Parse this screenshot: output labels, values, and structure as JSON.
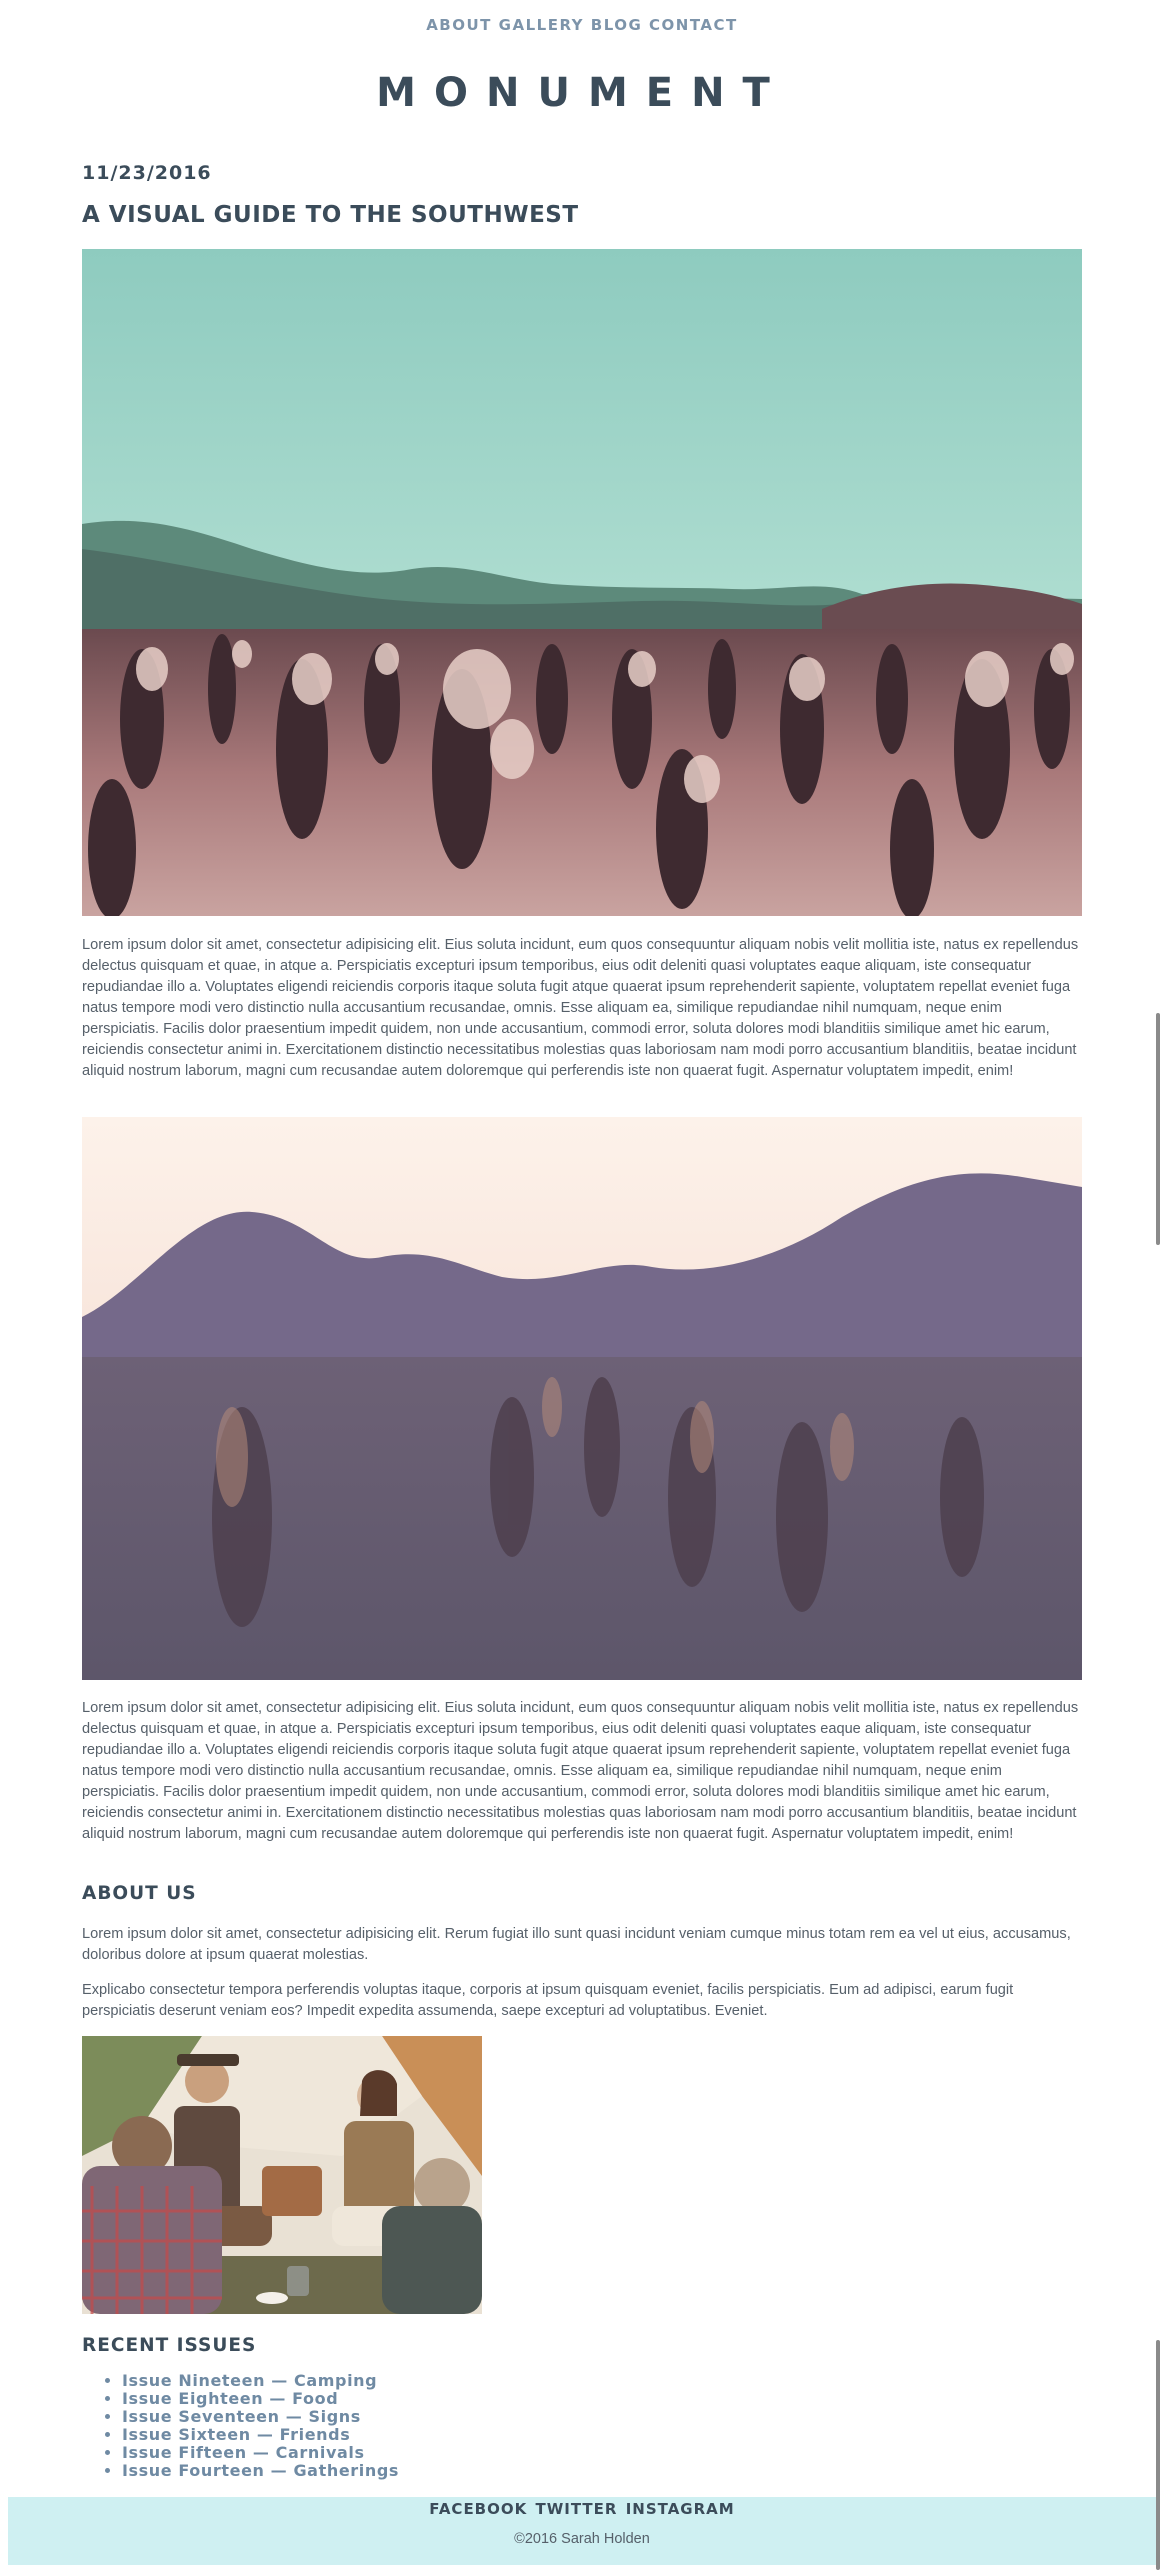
{
  "nav": {
    "links": [
      "ABOUT",
      "GALLERY",
      "BLOG",
      "CONTACT"
    ]
  },
  "site": {
    "brand": "MONUMENT"
  },
  "post": {
    "date": "11/23/2016",
    "title": "A VISUAL GUIDE TO THE SOUTHWEST",
    "paragraph1": "Lorem ipsum dolor sit amet, consectetur adipisicing elit. Eius soluta incidunt, eum quos consequuntur aliquam nobis velit mollitia iste, natus ex repellendus delectus quisquam et quae, in atque a. Perspiciatis excepturi ipsum temporibus, eius odit deleniti quasi voluptates eaque aliquam, iste consequatur repudiandae illo a. Voluptates eligendi reiciendis corporis itaque soluta fugit atque quaerat ipsum reprehenderit sapiente, voluptatem repellat eveniet fuga natus tempore modi vero distinctio nulla accusantium recusandae, omnis. Esse aliquam ea, similique repudiandae nihil numquam, neque enim perspiciatis. Facilis dolor praesentium impedit quidem, non unde accusantium, commodi error, soluta dolores modi blanditiis similique amet hic earum, reiciendis consectetur animi in. Exercitationem distinctio necessitatibus molestias quas laboriosam nam modi porro accusantium blanditiis, beatae incidunt aliquid nostrum laborum, magni cum recusandae autem doloremque qui perferendis iste non quaerat fugit. Aspernatur voluptatem impedit, enim!",
    "paragraph2": "Lorem ipsum dolor sit amet, consectetur adipisicing elit. Eius soluta incidunt, eum quos consequuntur aliquam nobis velit mollitia iste, natus ex repellendus delectus quisquam et quae, in atque a. Perspiciatis excepturi ipsum temporibus, eius odit deleniti quasi voluptates eaque aliquam, iste consequatur repudiandae illo a. Voluptates eligendi reiciendis corporis itaque soluta fugit atque quaerat ipsum reprehenderit sapiente, voluptatem repellat eveniet fuga natus tempore modi vero distinctio nulla accusantium recusandae, omnis. Esse aliquam ea, similique repudiandae nihil numquam, neque enim perspiciatis. Facilis dolor praesentium impedit quidem, non unde accusantium, commodi error, soluta dolores modi blanditiis similique amet hic earum, reiciendis consectetur animi in. Exercitationem distinctio necessitatibus molestias quas laboriosam nam modi porro accusantium blanditiis, beatae incidunt aliquid nostrum laborum, magni cum recusandae autem doloremque qui perferendis iste non quaerat fugit. Aspernatur voluptatem impedit, enim!"
  },
  "about": {
    "heading": "ABOUT US",
    "paragraph1": "Lorem ipsum dolor sit amet, consectetur adipisicing elit. Rerum fugiat illo sunt quasi incidunt veniam cumque minus totam rem ea vel ut eius, accusamus, doloribus dolore at ipsum quaerat molestias.",
    "paragraph2": "Explicabo consectetur tempora perferendis voluptas itaque, corporis at ipsum quisquam eveniet, facilis perspiciatis. Eum ad adipisci, earum fugit perspiciatis deserunt veniam eos? Impedit expedita assumenda, saepe excepturi ad voluptatibus. Eveniet."
  },
  "recent": {
    "heading": "RECENT ISSUES",
    "issues": [
      "Issue Nineteen — Camping",
      "Issue Eighteen — Food",
      "Issue Seventeen — Signs",
      "Issue Sixteen — Friends",
      "Issue Fifteen — Carnivals",
      "Issue Fourteen — Gatherings"
    ]
  },
  "footer": {
    "social": [
      "FACEBOOK",
      "TWITTER",
      "INSTAGRAM"
    ],
    "copyright": "©2016 Sarah Holden"
  },
  "colors": {
    "heading": "#3b4c5a",
    "nav_link": "#7d94aa",
    "issue_link": "#6f8aa3",
    "footer_bg": "#cff0f2"
  }
}
